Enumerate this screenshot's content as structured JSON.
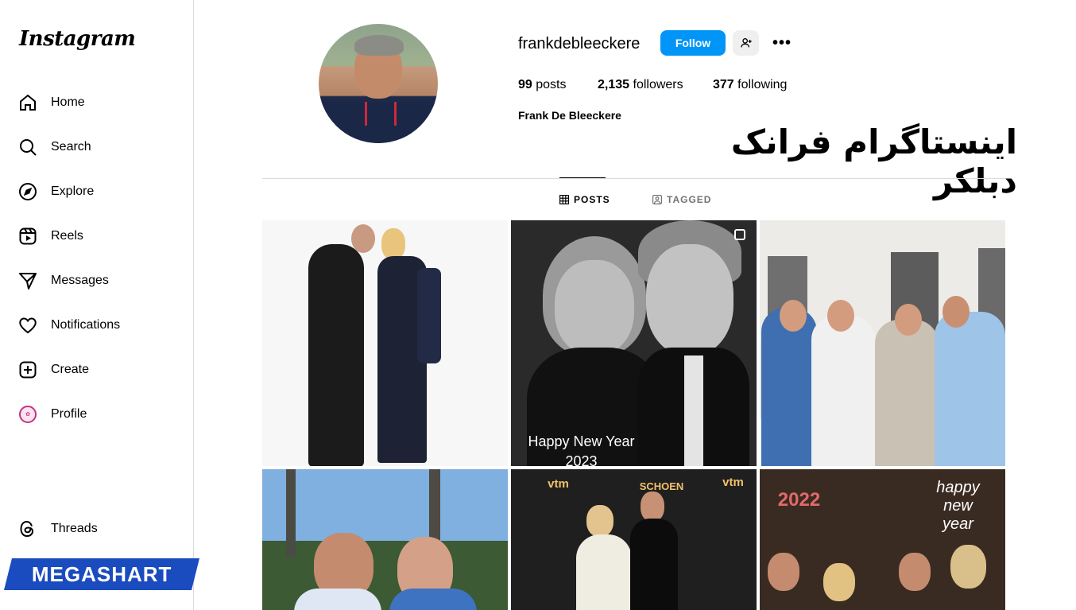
{
  "app": {
    "logo": "Instagram"
  },
  "sidebar": {
    "items": [
      {
        "label": "Home",
        "icon": "home-icon"
      },
      {
        "label": "Search",
        "icon": "search-icon"
      },
      {
        "label": "Explore",
        "icon": "compass-icon"
      },
      {
        "label": "Reels",
        "icon": "reels-icon"
      },
      {
        "label": "Messages",
        "icon": "send-icon"
      },
      {
        "label": "Notifications",
        "icon": "heart-icon"
      },
      {
        "label": "Create",
        "icon": "plus-square-icon"
      },
      {
        "label": "Profile",
        "icon": "avatar"
      }
    ],
    "threads": {
      "label": "Threads",
      "icon": "threads-icon"
    }
  },
  "profile": {
    "username": "frankdebleeckere",
    "follow_label": "Follow",
    "posts_count": "99",
    "posts_label": "posts",
    "followers_count": "2,135",
    "followers_label": "followers",
    "following_count": "377",
    "following_label": "following",
    "full_name": "Frank De Bleeckere"
  },
  "overlay": {
    "persian_title": "اینستاگرام فرانک دبلکر",
    "watermark": "MEGASHART"
  },
  "tabs": [
    {
      "label": "POSTS",
      "active": true,
      "icon": "grid-icon"
    },
    {
      "label": "TAGGED",
      "active": false,
      "icon": "tagged-icon"
    }
  ],
  "posts": {
    "post2_caption_line1": "Happy New Year",
    "post2_caption_line2": "2023",
    "post5_logo_left": "vtm",
    "post5_logo_right": "vtm",
    "post5_banner": "SCHOEN",
    "post6_year": "2022",
    "post6_line1": "happy",
    "post6_line2": "new",
    "post6_line3": "year"
  },
  "colors": {
    "accent": "#0095f6",
    "watermark_bg": "#1a4bbf",
    "divider": "#dbdbdb"
  }
}
